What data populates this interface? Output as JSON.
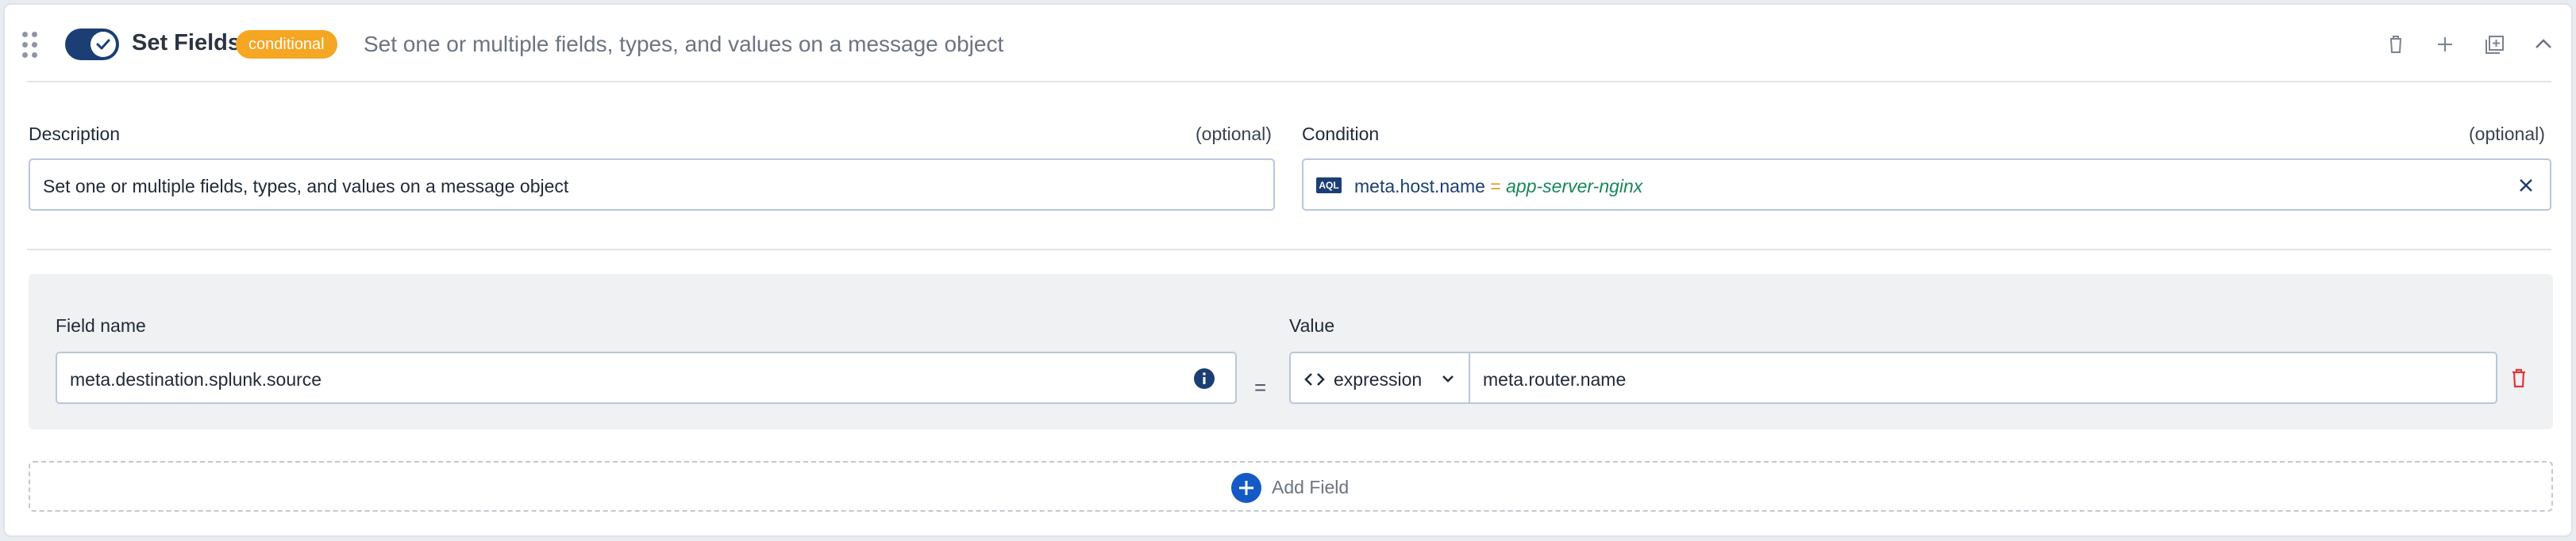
{
  "header": {
    "title": "Set Fields",
    "badge": "conditional",
    "subtitle": "Set one or multiple fields, types, and values on a message object",
    "icons": [
      "trash-icon",
      "plus-icon",
      "duplicate-icon",
      "chevron-up-icon"
    ],
    "toggle_on": true
  },
  "description": {
    "label": "Description",
    "optional": "(optional)",
    "value": "Set one or multiple fields, types, and values on a message object"
  },
  "condition": {
    "label": "Condition",
    "optional": "(optional)",
    "badge": "AQL",
    "field": "meta.host.name",
    "operator": " = ",
    "value": "app-server-nginx"
  },
  "fields": {
    "field_label": "Field name",
    "value_label": "Value",
    "rows": [
      {
        "field": "meta.destination.splunk.source",
        "operator": "=",
        "type": "expression",
        "value": "meta.router.name"
      }
    ]
  },
  "add_field": {
    "label": "Add Field"
  },
  "colors": {
    "primary": "#1b3f75",
    "badge": "#f5a623",
    "condition_value": "#18865a",
    "delete": "#e0353b"
  }
}
